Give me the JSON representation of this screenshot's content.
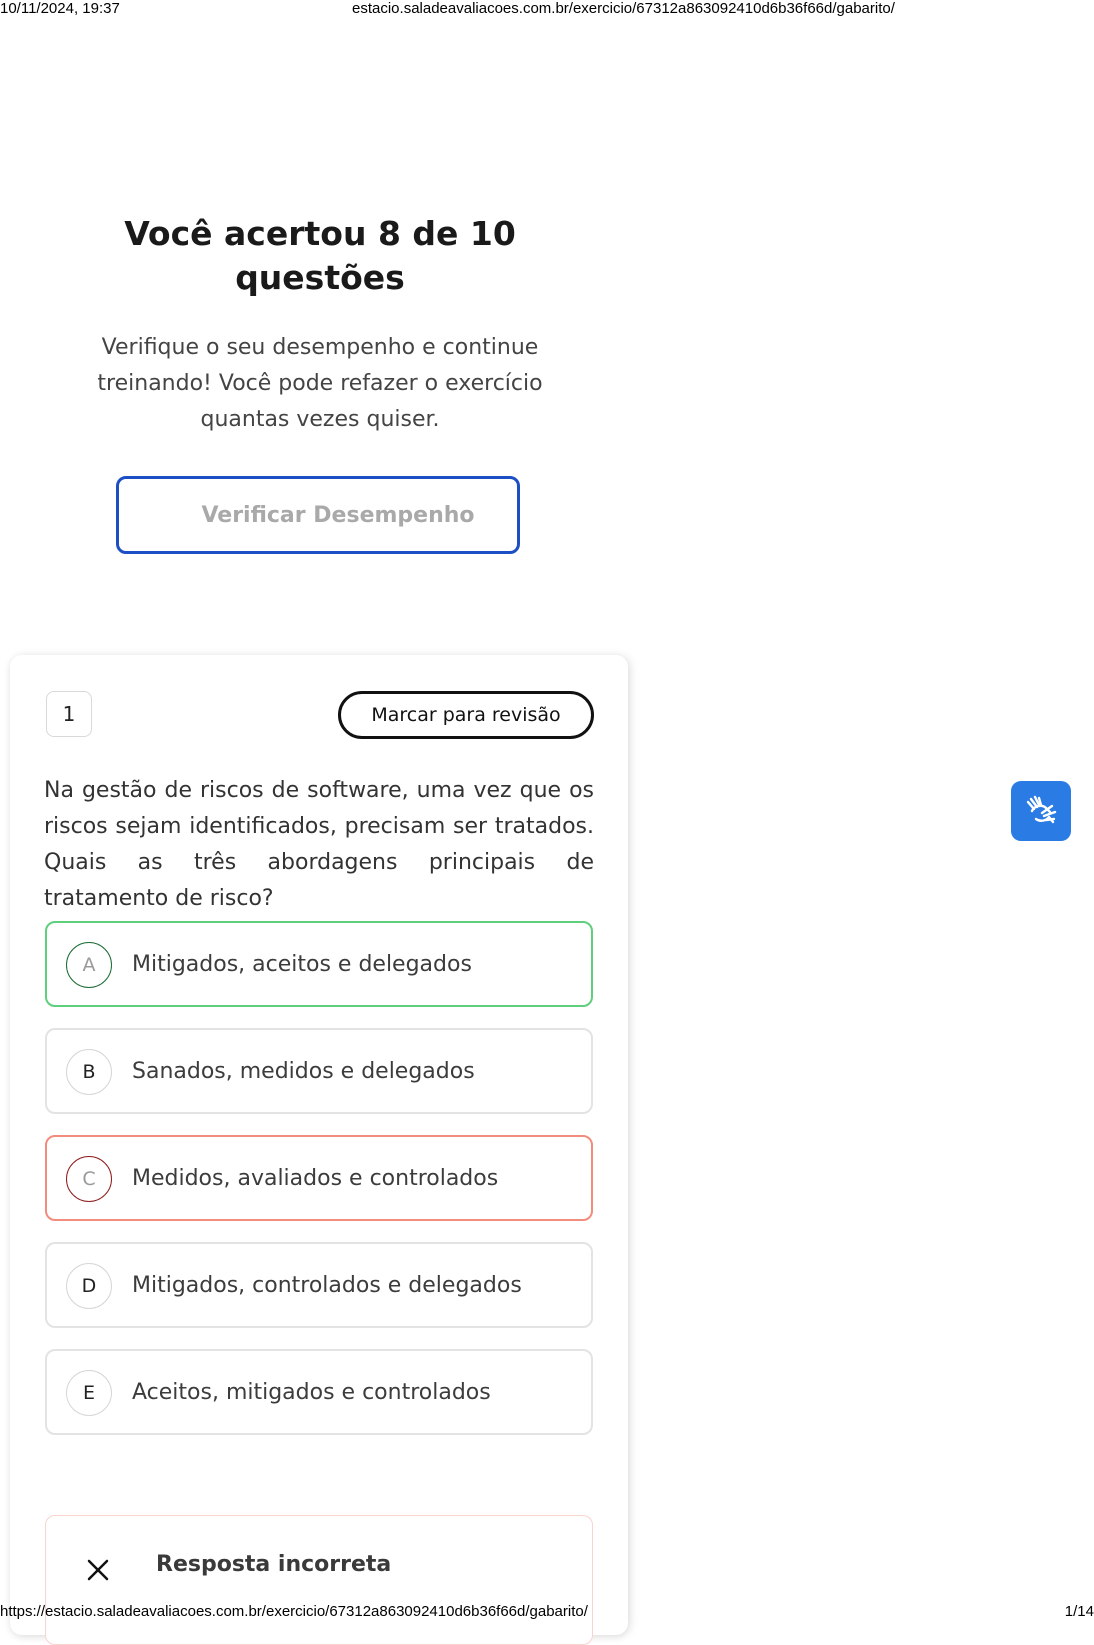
{
  "print_header": {
    "datetime": "10/11/2024, 19:37",
    "url": "estacio.saladeavaliacoes.com.br/exercicio/67312a863092410d6b36f66d/gabarito/"
  },
  "print_footer": {
    "url": "https://estacio.saladeavaliacoes.com.br/exercicio/67312a863092410d6b36f66d/gabarito/",
    "page": "1/14"
  },
  "result": {
    "title": "Você acertou 8 de 10 questões",
    "subtitle": "Verifique o seu desempenho e continue treinando! Você pode refazer o exercício quantas vezes quiser.",
    "button_label": "Verificar Desempenho"
  },
  "question": {
    "number": "1",
    "review_label": "Marcar para revisão",
    "text": "Na gestão de riscos de software, uma vez que os riscos sejam identificados, precisam ser tratados. Quais as três abordagens principais de tratamento de risco?",
    "options": [
      {
        "letter": "A",
        "text": "Mitigados, aceitos e delegados",
        "state": "correct"
      },
      {
        "letter": "B",
        "text": "Sanados, medidos e delegados",
        "state": "neutral"
      },
      {
        "letter": "C",
        "text": "Medidos, avaliados e controlados",
        "state": "wrong"
      },
      {
        "letter": "D",
        "text": "Mitigados, controlados e delegados",
        "state": "neutral"
      },
      {
        "letter": "E",
        "text": "Aceitos, mitigados e controlados",
        "state": "neutral"
      }
    ],
    "feedback": {
      "title": "Resposta incorreta",
      "icon": "close-icon"
    }
  },
  "accessibility": {
    "icon": "sign-language-icon"
  },
  "colors": {
    "primary_blue": "#1d4fc4",
    "correct_green": "#5fcf7e",
    "wrong_red": "#f28c7c",
    "accessibility_blue": "#2a7be4"
  }
}
